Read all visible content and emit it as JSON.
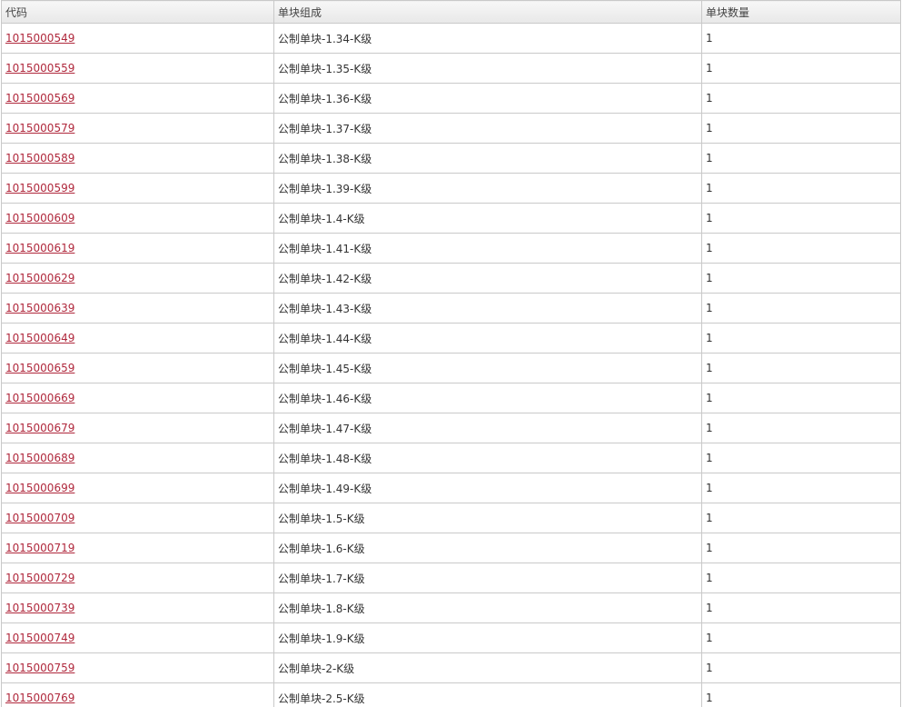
{
  "table": {
    "headers": [
      "代码",
      "单块组成",
      "单块数量"
    ],
    "rows": [
      {
        "code": "1015000549",
        "composition": "公制单块-1.34-K级",
        "quantity": "1"
      },
      {
        "code": "1015000559",
        "composition": "公制单块-1.35-K级",
        "quantity": "1"
      },
      {
        "code": "1015000569",
        "composition": "公制单块-1.36-K级",
        "quantity": "1"
      },
      {
        "code": "1015000579",
        "composition": "公制单块-1.37-K级",
        "quantity": "1"
      },
      {
        "code": "1015000589",
        "composition": "公制单块-1.38-K级",
        "quantity": "1"
      },
      {
        "code": "1015000599",
        "composition": "公制单块-1.39-K级",
        "quantity": "1"
      },
      {
        "code": "1015000609",
        "composition": "公制单块-1.4-K级",
        "quantity": "1"
      },
      {
        "code": "1015000619",
        "composition": "公制单块-1.41-K级",
        "quantity": "1"
      },
      {
        "code": "1015000629",
        "composition": "公制单块-1.42-K级",
        "quantity": "1"
      },
      {
        "code": "1015000639",
        "composition": "公制单块-1.43-K级",
        "quantity": "1"
      },
      {
        "code": "1015000649",
        "composition": "公制单块-1.44-K级",
        "quantity": "1"
      },
      {
        "code": "1015000659",
        "composition": "公制单块-1.45-K级",
        "quantity": "1"
      },
      {
        "code": "1015000669",
        "composition": "公制单块-1.46-K级",
        "quantity": "1"
      },
      {
        "code": "1015000679",
        "composition": "公制单块-1.47-K级",
        "quantity": "1"
      },
      {
        "code": "1015000689",
        "composition": "公制单块-1.48-K级",
        "quantity": "1"
      },
      {
        "code": "1015000699",
        "composition": "公制单块-1.49-K级",
        "quantity": "1"
      },
      {
        "code": "1015000709",
        "composition": "公制单块-1.5-K级",
        "quantity": "1"
      },
      {
        "code": "1015000719",
        "composition": "公制单块-1.6-K级",
        "quantity": "1"
      },
      {
        "code": "1015000729",
        "composition": "公制单块-1.7-K级",
        "quantity": "1"
      },
      {
        "code": "1015000739",
        "composition": "公制单块-1.8-K级",
        "quantity": "1"
      },
      {
        "code": "1015000749",
        "composition": "公制单块-1.9-K级",
        "quantity": "1"
      },
      {
        "code": "1015000759",
        "composition": "公制单块-2-K级",
        "quantity": "1"
      },
      {
        "code": "1015000769",
        "composition": "公制单块-2.5-K级",
        "quantity": "1"
      }
    ]
  },
  "colors": {
    "link": "#b0283c",
    "border": "#c9c9c9",
    "header_bg": "#ececec"
  }
}
